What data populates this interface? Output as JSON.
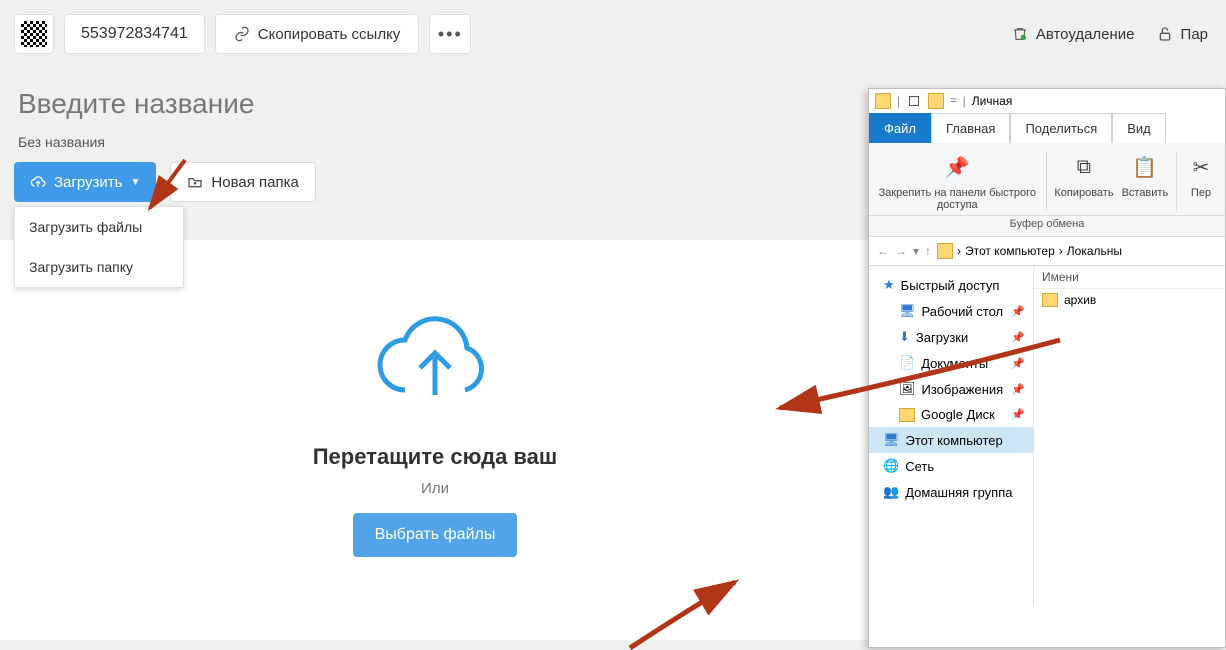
{
  "topbar": {
    "id_number": "553972834741",
    "copy_link": "Скопировать ссылку",
    "auto_delete": "Автоудаление",
    "password": "Пар"
  },
  "title_placeholder": "Введите название",
  "subtitle": "Без названия",
  "upload_btn": "Загрузить",
  "newfolder_btn": "Новая папка",
  "dropdown": {
    "files": "Загрузить файлы",
    "folder": "Загрузить папку"
  },
  "dropzone": {
    "prompt": "Перетащите сюда ваш",
    "or": "Или",
    "select": "Выбрать файлы"
  },
  "explorer": {
    "title": "Личная",
    "tabs": {
      "file": "Файл",
      "main": "Главная",
      "share": "Поделиться",
      "view": "Вид"
    },
    "ribbon": {
      "pin": "Закрепить на панели быстрого доступа",
      "copy": "Копировать",
      "paste": "Вставить",
      "section": "Буфер обмена",
      "per": "Пер"
    },
    "breadcrumb": {
      "a": "Этот компьютер",
      "b": "Локальны"
    },
    "col_header": "Имени",
    "tree": {
      "quick": "Быстрый доступ",
      "desktop": "Рабочий стол",
      "downloads": "Загрузки",
      "documents": "Документы",
      "pictures": "Изображения",
      "gdrive": "Google Диск",
      "this_pc": "Этот компьютер",
      "network": "Сеть",
      "homegroup": "Домашняя группа"
    },
    "files": {
      "archive": "архив"
    }
  }
}
